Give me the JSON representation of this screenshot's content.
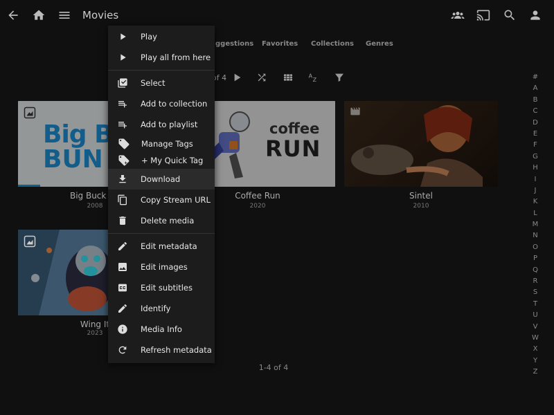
{
  "header": {
    "title": "Movies",
    "icons": [
      "back-arrow-icon",
      "home-icon",
      "menu-icon",
      "users-icon",
      "cast-icon",
      "search-icon",
      "user-icon"
    ]
  },
  "tabs": [
    "Suggestions",
    "Favorites",
    "Collections",
    "Genres"
  ],
  "tabs_visible": {
    "suggestions_partial": "ggestions"
  },
  "toolbar": {
    "page_partial": "of 4"
  },
  "movies": [
    {
      "title": "Big Buck Bunny",
      "title_visible": "Big Buck Bu",
      "year": "2008"
    },
    {
      "title": "Coffee Run",
      "year": "2020"
    },
    {
      "title": "Sintel",
      "year": "2010"
    },
    {
      "title": "Wing It!",
      "title_visible": "Wing It",
      "year": "2023"
    }
  ],
  "poster_text": {
    "bbb_line1": "Big Bu",
    "bbb_line2": "BUN",
    "coffee_line1": "coffee",
    "coffee_line2": "RUN"
  },
  "alphabet": [
    "#",
    "A",
    "B",
    "C",
    "D",
    "E",
    "F",
    "G",
    "H",
    "I",
    "J",
    "K",
    "L",
    "M",
    "N",
    "O",
    "P",
    "Q",
    "R",
    "S",
    "T",
    "U",
    "V",
    "W",
    "X",
    "Y",
    "Z"
  ],
  "footer": {
    "count": "1-4 of 4"
  },
  "context_menu": {
    "items": [
      {
        "label": "Play",
        "icon": "play-icon"
      },
      {
        "label": "Play all from here",
        "icon": "play-icon"
      },
      {
        "label": "Select",
        "icon": "select-icon"
      },
      {
        "label": "Add to collection",
        "icon": "playlist-add-icon"
      },
      {
        "label": "Add to playlist",
        "icon": "playlist-add-icon"
      },
      {
        "label": "Manage Tags",
        "icon": "tag-icon"
      },
      {
        "label": "+ My Quick Tag",
        "icon": "tag-plus-icon"
      },
      {
        "label": "Download",
        "icon": "download-icon"
      },
      {
        "label": "Copy Stream URL",
        "icon": "copy-icon"
      },
      {
        "label": "Delete media",
        "icon": "trash-icon"
      },
      {
        "label": "Edit metadata",
        "icon": "pencil-icon"
      },
      {
        "label": "Edit images",
        "icon": "image-icon"
      },
      {
        "label": "Edit subtitles",
        "icon": "subtitles-icon"
      },
      {
        "label": "Identify",
        "icon": "pencil-icon"
      },
      {
        "label": "Media Info",
        "icon": "info-icon"
      },
      {
        "label": "Refresh metadata",
        "icon": "refresh-icon"
      }
    ],
    "highlighted": "Download"
  },
  "colors": {
    "background": "#101010",
    "menu": "#1c1c1c",
    "menu_highlight": "#2b2b2b",
    "bbb_blue": "#1e8fd6",
    "coffee_dark": "#222222"
  }
}
